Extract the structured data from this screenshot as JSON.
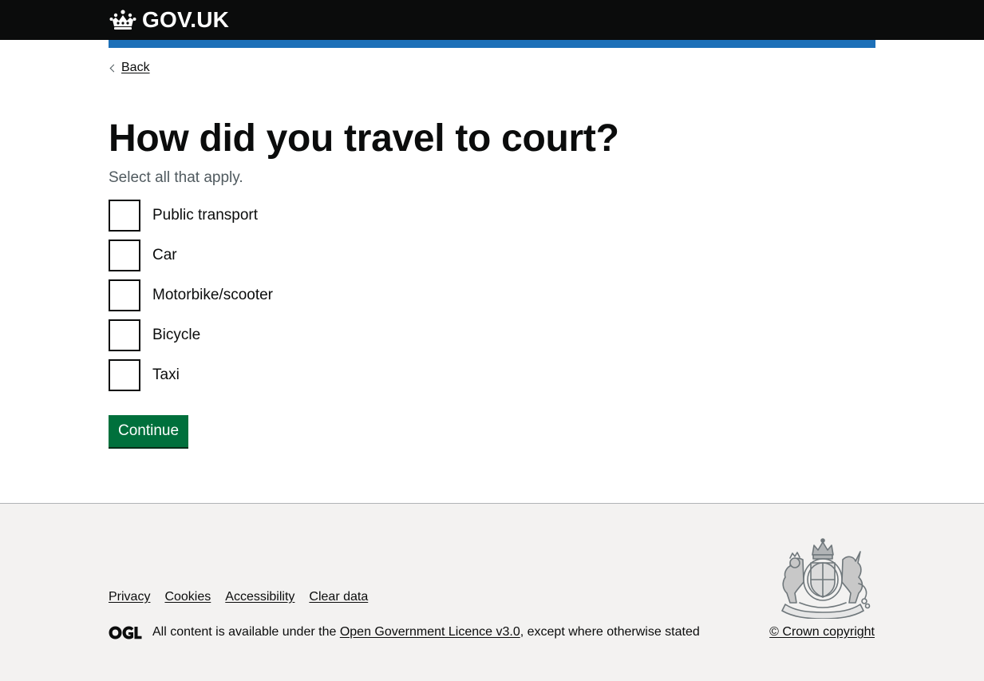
{
  "header": {
    "logo_text": "GOV.UK",
    "logo_icon": "crown-icon",
    "bar_color": "#1d70b8",
    "background_color": "#0b0c0c"
  },
  "back_link": {
    "label": "Back"
  },
  "question": {
    "title": "How did you travel to court?",
    "hint": "Select all that apply."
  },
  "options": [
    {
      "label": "Public transport",
      "checked": false
    },
    {
      "label": "Car",
      "checked": false
    },
    {
      "label": "Motorbike/scooter",
      "checked": false
    },
    {
      "label": "Bicycle",
      "checked": false
    },
    {
      "label": "Taxi",
      "checked": false
    }
  ],
  "continue_button": {
    "label": "Continue",
    "color": "#00703c"
  },
  "footer": {
    "links": [
      "Privacy",
      "Cookies",
      "Accessibility",
      "Clear data"
    ],
    "licence_prefix": "All content is available under the",
    "licence_link": "Open Government Licence v3.0",
    "licence_suffix": ", except where otherwise stated",
    "copyright": "© Crown copyright",
    "logo_icon": "ogl-icon",
    "crest_icon": "royal-coat-of-arms-icon"
  }
}
